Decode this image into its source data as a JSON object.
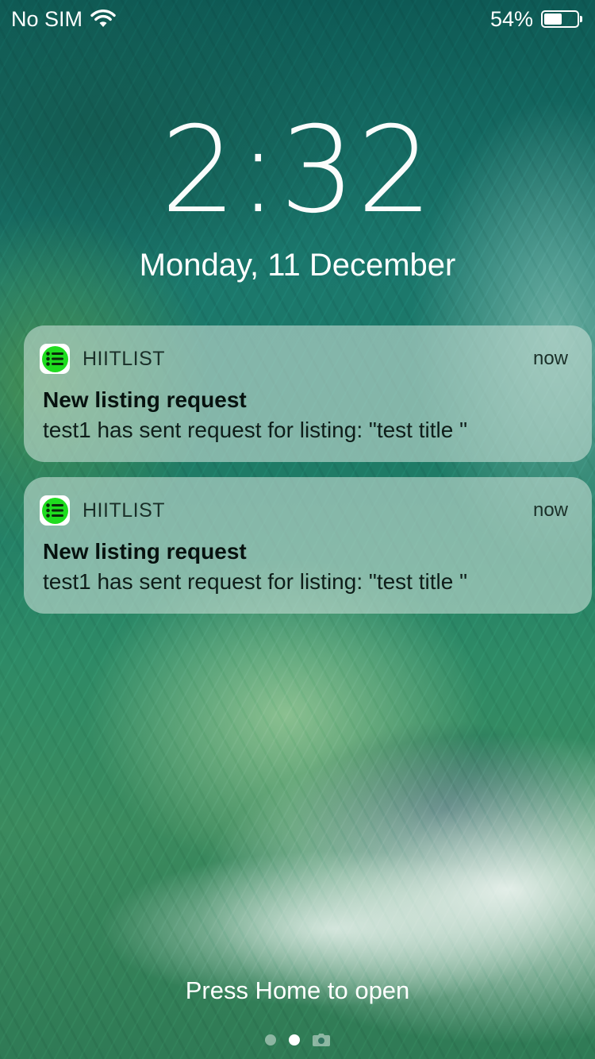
{
  "status_bar": {
    "carrier": "No SIM",
    "battery_percent_text": "54%",
    "battery_level": 0.54
  },
  "lock_screen": {
    "time": "2:32",
    "date": "Monday, 11 December",
    "press_home": "Press Home to open"
  },
  "notifications": [
    {
      "app_name": "HIITLIST",
      "time": "now",
      "title": "New listing request",
      "body": "test1 has sent request for listing: \"test title \""
    },
    {
      "app_name": "HIITLIST",
      "time": "now",
      "title": "New listing request",
      "body": "test1 has sent request for listing: \"test title \""
    }
  ],
  "icons": {
    "wifi": "wifi-icon",
    "battery": "battery-icon",
    "app": "list-icon",
    "camera": "camera-icon"
  },
  "colors": {
    "app_icon_green": "#1fdc1f"
  }
}
